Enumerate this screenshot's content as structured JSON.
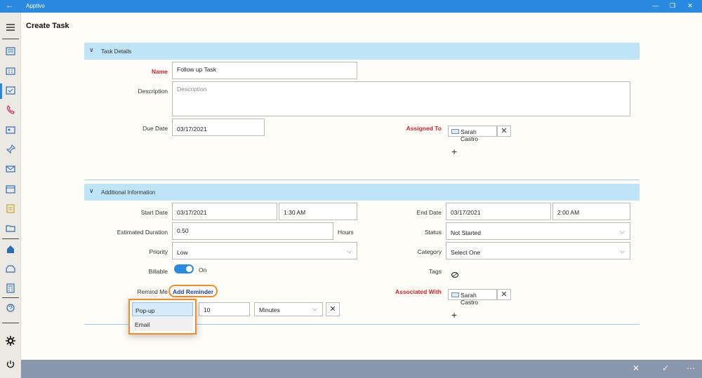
{
  "titlebar": {
    "back": "←",
    "app_title": "Apptivo",
    "minimize": "—",
    "restore": "❐",
    "close": "✕"
  },
  "sidebar": {
    "icons": [
      "menu-icon",
      "dashboard-icon",
      "building-icon",
      "task-icon",
      "call-icon",
      "contact-card-icon",
      "pin-icon",
      "mail-icon",
      "calendar-icon",
      "note-icon",
      "folder-icon",
      "home-icon",
      "inbox-icon",
      "calculator-icon",
      "support-icon",
      "settings-icon",
      "power-icon"
    ]
  },
  "header": {
    "title": "Create Task"
  },
  "task_details": {
    "section_label": "Task Details",
    "name_label": "Name",
    "name_value": "Follow up Task",
    "description_label": "Description",
    "description_placeholder": "Description",
    "due_date_label": "Due Date",
    "due_date_value": "03/17/2021",
    "assigned_to_label": "Assigned To",
    "assigned_to_chip": "Sarah Castro",
    "remove_glyph": "✕",
    "add_glyph": "+"
  },
  "additional": {
    "section_label": "Additional Information",
    "start_date_label": "Start Date",
    "start_date_value": "03/17/2021",
    "start_time_value": "1:30 AM",
    "end_date_label": "End Date",
    "end_date_value": "03/17/2021",
    "end_time_value": "2:00 AM",
    "duration_label": "Estimated Duration",
    "duration_value": "0.50",
    "duration_unit": "Hours",
    "status_label": "Status",
    "status_value": "Not Started",
    "priority_label": "Priority",
    "priority_value": "Low",
    "category_label": "Category",
    "category_value": "Select One",
    "billable_label": "Billable",
    "billable_state": "On",
    "tags_label": "Tags",
    "remind_label": "Remind Me",
    "add_reminder": "Add Reminder",
    "associated_label": "Associated With",
    "associated_chip": "Sarah Castro",
    "reminder_value": "10",
    "reminder_unit": "Minutes",
    "reminder_type_options": [
      "Pop-up",
      "Email"
    ]
  },
  "bottom_bar": {
    "cancel": "✕",
    "save": "✓",
    "more": "⋯"
  }
}
